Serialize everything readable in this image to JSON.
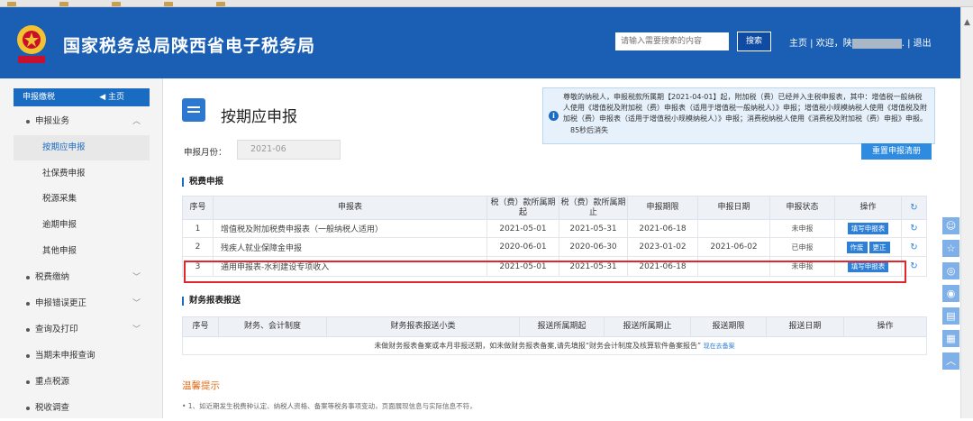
{
  "header": {
    "title": "国家税务总局陕西省电子税务局",
    "search_placeholder": "请输入需要搜索的内容",
    "search_button": "搜索",
    "home_link": "主页",
    "welcome_prefix": "欢迎，陕",
    "welcome_suffix": ".",
    "logout": "退出"
  },
  "sidebar": {
    "header_label": "申报缴税",
    "home_link": "主页",
    "items": [
      {
        "label": "申报业务",
        "level": 1,
        "expanded": true
      },
      {
        "label": "按期应申报",
        "level": 2,
        "active": true
      },
      {
        "label": "社保费申报",
        "level": 2
      },
      {
        "label": "税源采集",
        "level": 2
      },
      {
        "label": "逾期申报",
        "level": 2
      },
      {
        "label": "其他申报",
        "level": 2
      },
      {
        "label": "税费缴纳",
        "level": 1
      },
      {
        "label": "申报错误更正",
        "level": 1
      },
      {
        "label": "查询及打印",
        "level": 1
      },
      {
        "label": "当期未申报查询",
        "level": 1
      },
      {
        "label": "重点税源",
        "level": 1
      },
      {
        "label": "税收调查",
        "level": 1
      }
    ]
  },
  "page": {
    "title": "按期应申报",
    "month_label": "申报月份：",
    "month_value": "2021-06",
    "reset_button": "重置申报清册",
    "notice": "尊敬的纳税人，申报税款所属期【2021-04-01】起，附加税（费）已经并入主税申报表，其中：增值税一般纳税人使用《增值税及附加税（费）申报表（适用于增值税一般纳税人）》申报；增值税小规模纳税人使用《增值税及附加税（费）申报表（适用于增值税小规模纳税人）》申报；消费税纳税人使用《消费税及附加税（费）申报》申报。",
    "notice_countdown": "85秒后消失"
  },
  "tax_section": {
    "title": "税费申报",
    "columns": [
      "序号",
      "申报表",
      "税（费）款所属期起",
      "税（费）款所属期止",
      "申报期限",
      "申报日期",
      "申报状态",
      "操作"
    ],
    "rows": [
      {
        "no": "1",
        "form": "增值税及附加税费申报表（一般纳税人适用）",
        "start": "2021-05-01",
        "end": "2021-05-31",
        "deadline": "2021-06-18",
        "date": "",
        "status": "未申报",
        "actions": [
          "填写申报表"
        ]
      },
      {
        "no": "2",
        "form": "残疾人就业保障金申报",
        "start": "2020-06-01",
        "end": "2020-06-30",
        "deadline": "2023-01-02",
        "date": "2021-06-02",
        "status": "已申报",
        "actions": [
          "作废",
          "更正"
        ]
      },
      {
        "no": "3",
        "form": "通用申报表-水利建设专项收入",
        "start": "2021-05-01",
        "end": "2021-05-31",
        "deadline": "2021-06-18",
        "date": "",
        "status": "未申报",
        "actions": [
          "填写申报表"
        ]
      }
    ]
  },
  "fin_section": {
    "title": "财务报表报送",
    "columns": [
      "序号",
      "财务、会计制度",
      "财务报表报送小类",
      "报送所属期起",
      "报送所属期止",
      "报送期限",
      "报送日期",
      "操作"
    ],
    "empty_text": "未做财务报表备案或本月非报送期，如未做财务报表备案,请先填报“财务会计制度及核算软件备案报告”",
    "empty_link": "现在去备案"
  },
  "tips": {
    "title": "温馨提示",
    "line1": "• 1、如近期发生税费种认定、纳税人资格、备案等税务事项变动，页面展现信息与实际信息不符，"
  },
  "colors": {
    "header_bg": "#1a5fb4",
    "accent": "#2e7fd6",
    "highlight": "#e0282c"
  }
}
